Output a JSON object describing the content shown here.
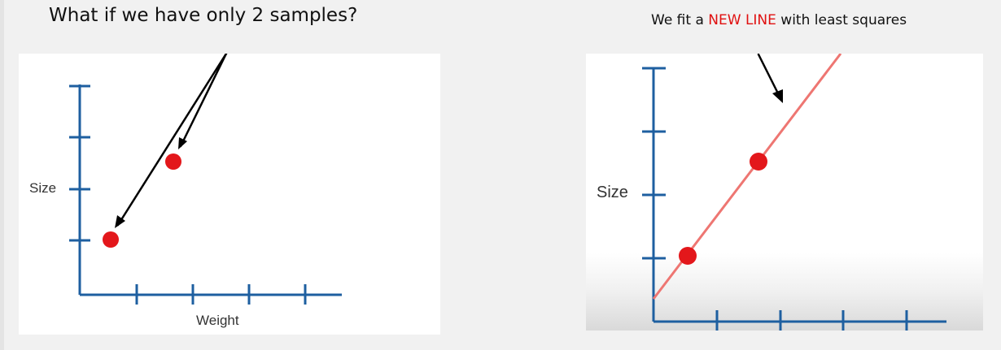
{
  "left": {
    "title": "What if we have only 2 samples?",
    "ylabel": "Size",
    "xlabel": "Weight"
  },
  "right": {
    "title_prefix": "We fit a ",
    "title_highlight": "NEW LINE",
    "title_suffix": " with least squares",
    "ylabel": "Size"
  },
  "colors": {
    "axis": "#1e5fa0",
    "point": "#e3171b",
    "fit_line": "#ee7672",
    "arrow": "#000000",
    "highlight": "#e01010"
  }
}
